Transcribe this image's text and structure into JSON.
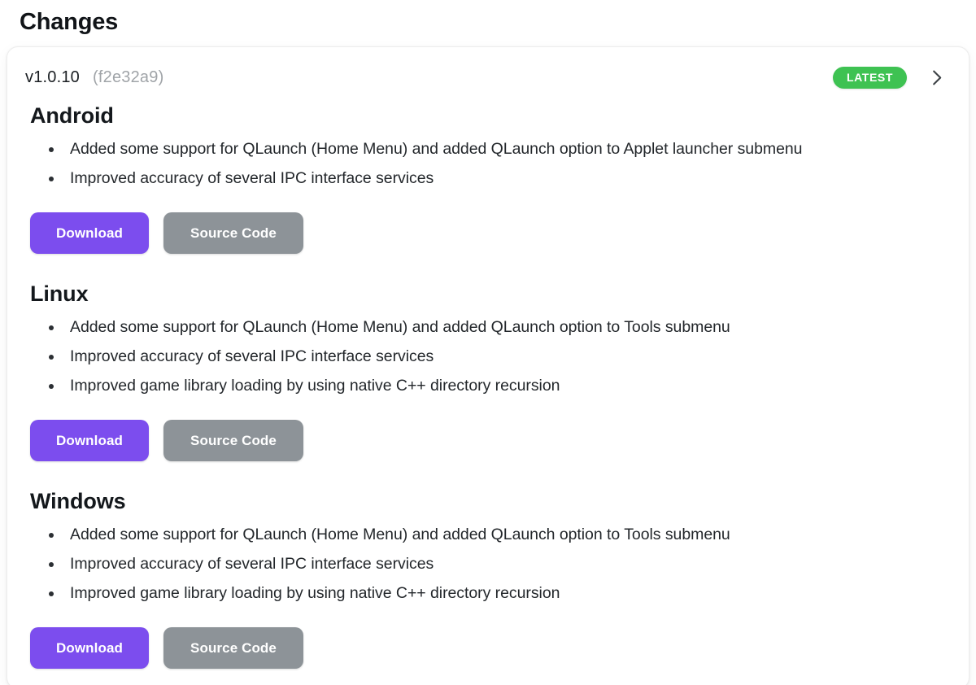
{
  "page": {
    "title": "Changes"
  },
  "release": {
    "version": "v1.0.10",
    "commit": "(f2e32a9)",
    "badge": "LATEST",
    "expand_icon": "chevron-right-icon",
    "colors": {
      "badge_green": "#3ec252",
      "download_purple": "#7c4dee",
      "source_gray": "#8d9398",
      "commit_gray": "#a0a4a8"
    },
    "buttons": {
      "download": "Download",
      "source_code": "Source Code"
    },
    "platforms": [
      {
        "name": "Android",
        "changes": [
          "Added some support for QLaunch (Home Menu) and added QLaunch option to Applet launcher submenu",
          "Improved accuracy of several IPC interface services"
        ]
      },
      {
        "name": "Linux",
        "changes": [
          "Added some support for QLaunch (Home Menu) and added QLaunch option to Tools submenu",
          "Improved accuracy of several IPC interface services",
          "Improved game library loading by using native C++ directory recursion"
        ]
      },
      {
        "name": "Windows",
        "changes": [
          "Added some support for QLaunch (Home Menu) and added QLaunch option to Tools submenu",
          "Improved accuracy of several IPC interface services",
          "Improved game library loading by using native C++ directory recursion"
        ]
      }
    ]
  }
}
